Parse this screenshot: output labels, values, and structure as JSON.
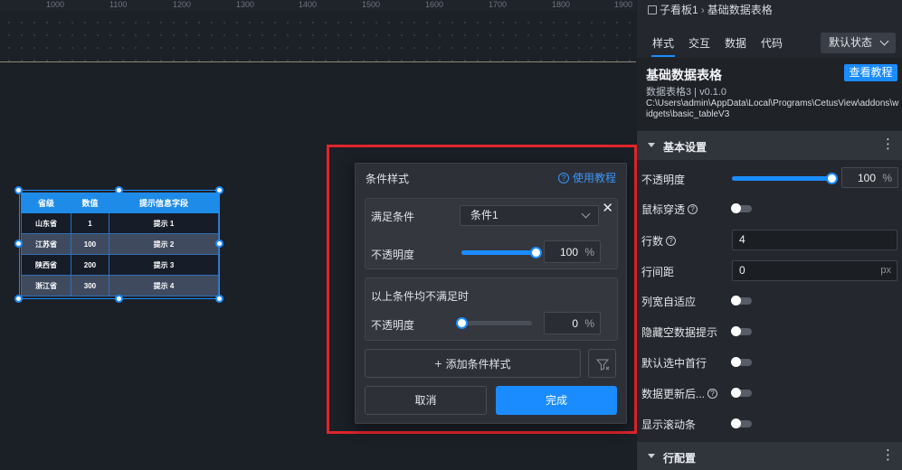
{
  "ruler": {
    "ticks": [
      "1000",
      "1100",
      "1200",
      "1300",
      "1400",
      "1500",
      "1600",
      "1700",
      "1800",
      "1900"
    ]
  },
  "table_widget": {
    "headers": [
      "省级",
      "数值",
      "提示信息字段"
    ],
    "rows": [
      [
        "山东省",
        "1",
        "提示 1"
      ],
      [
        "江苏省",
        "100",
        "提示 2"
      ],
      [
        "陕西省",
        "200",
        "提示 3"
      ],
      [
        "浙江省",
        "300",
        "提示 4"
      ]
    ]
  },
  "dialog": {
    "title": "条件样式",
    "help_link": "使用教程",
    "condition_label": "满足条件",
    "condition_value": "条件1",
    "opacity_label": "不透明度",
    "opacity_value": "100",
    "opacity_level": 1.0,
    "opacity_unit": "%",
    "fallback_title": "以上条件均不满足时",
    "fallback_opacity_label": "不透明度",
    "fallback_opacity_value": "0",
    "fallback_opacity_level": 0.0,
    "fallback_opacity_unit": "%",
    "add_button": "添加条件样式",
    "cancel_button": "取消",
    "ok_button": "完成"
  },
  "panel": {
    "breadcrumb_parent": "子看板1",
    "breadcrumb_current": "基础数据表格",
    "tabs": [
      "样式",
      "交互",
      "数据",
      "代码"
    ],
    "state_select": "默认状态",
    "widget_name": "基础数据表格",
    "widget_version": "数据表格3 | v0.1.0",
    "widget_path": "C:\\Users\\admin\\AppData\\Local\\Programs\\CetusView\\addons\\widgets\\basic_tableV3",
    "tutorial_button": "查看教程",
    "section_basic": "基本设置",
    "section_row": "行配置",
    "settings": {
      "opacity_label": "不透明度",
      "opacity_value": "100",
      "opacity_unit": "%",
      "mouse_through_label": "鼠标穿透",
      "row_count_label": "行数",
      "row_count_value": "4",
      "row_spacing_label": "行间距",
      "row_spacing_value": "0",
      "row_spacing_unit": "px",
      "col_autofit_label": "列宽自适应",
      "hide_empty_label": "隐藏空数据提示",
      "select_first_label": "默认选中首行",
      "data_update_label": "数据更新后...",
      "show_scrollbar_label": "显示滚动条"
    }
  },
  "colors": {
    "accent": "#1a8cff",
    "highlight": "#e0252b",
    "panel_bg": "#24272d",
    "canvas_bg": "#1b1f26"
  }
}
